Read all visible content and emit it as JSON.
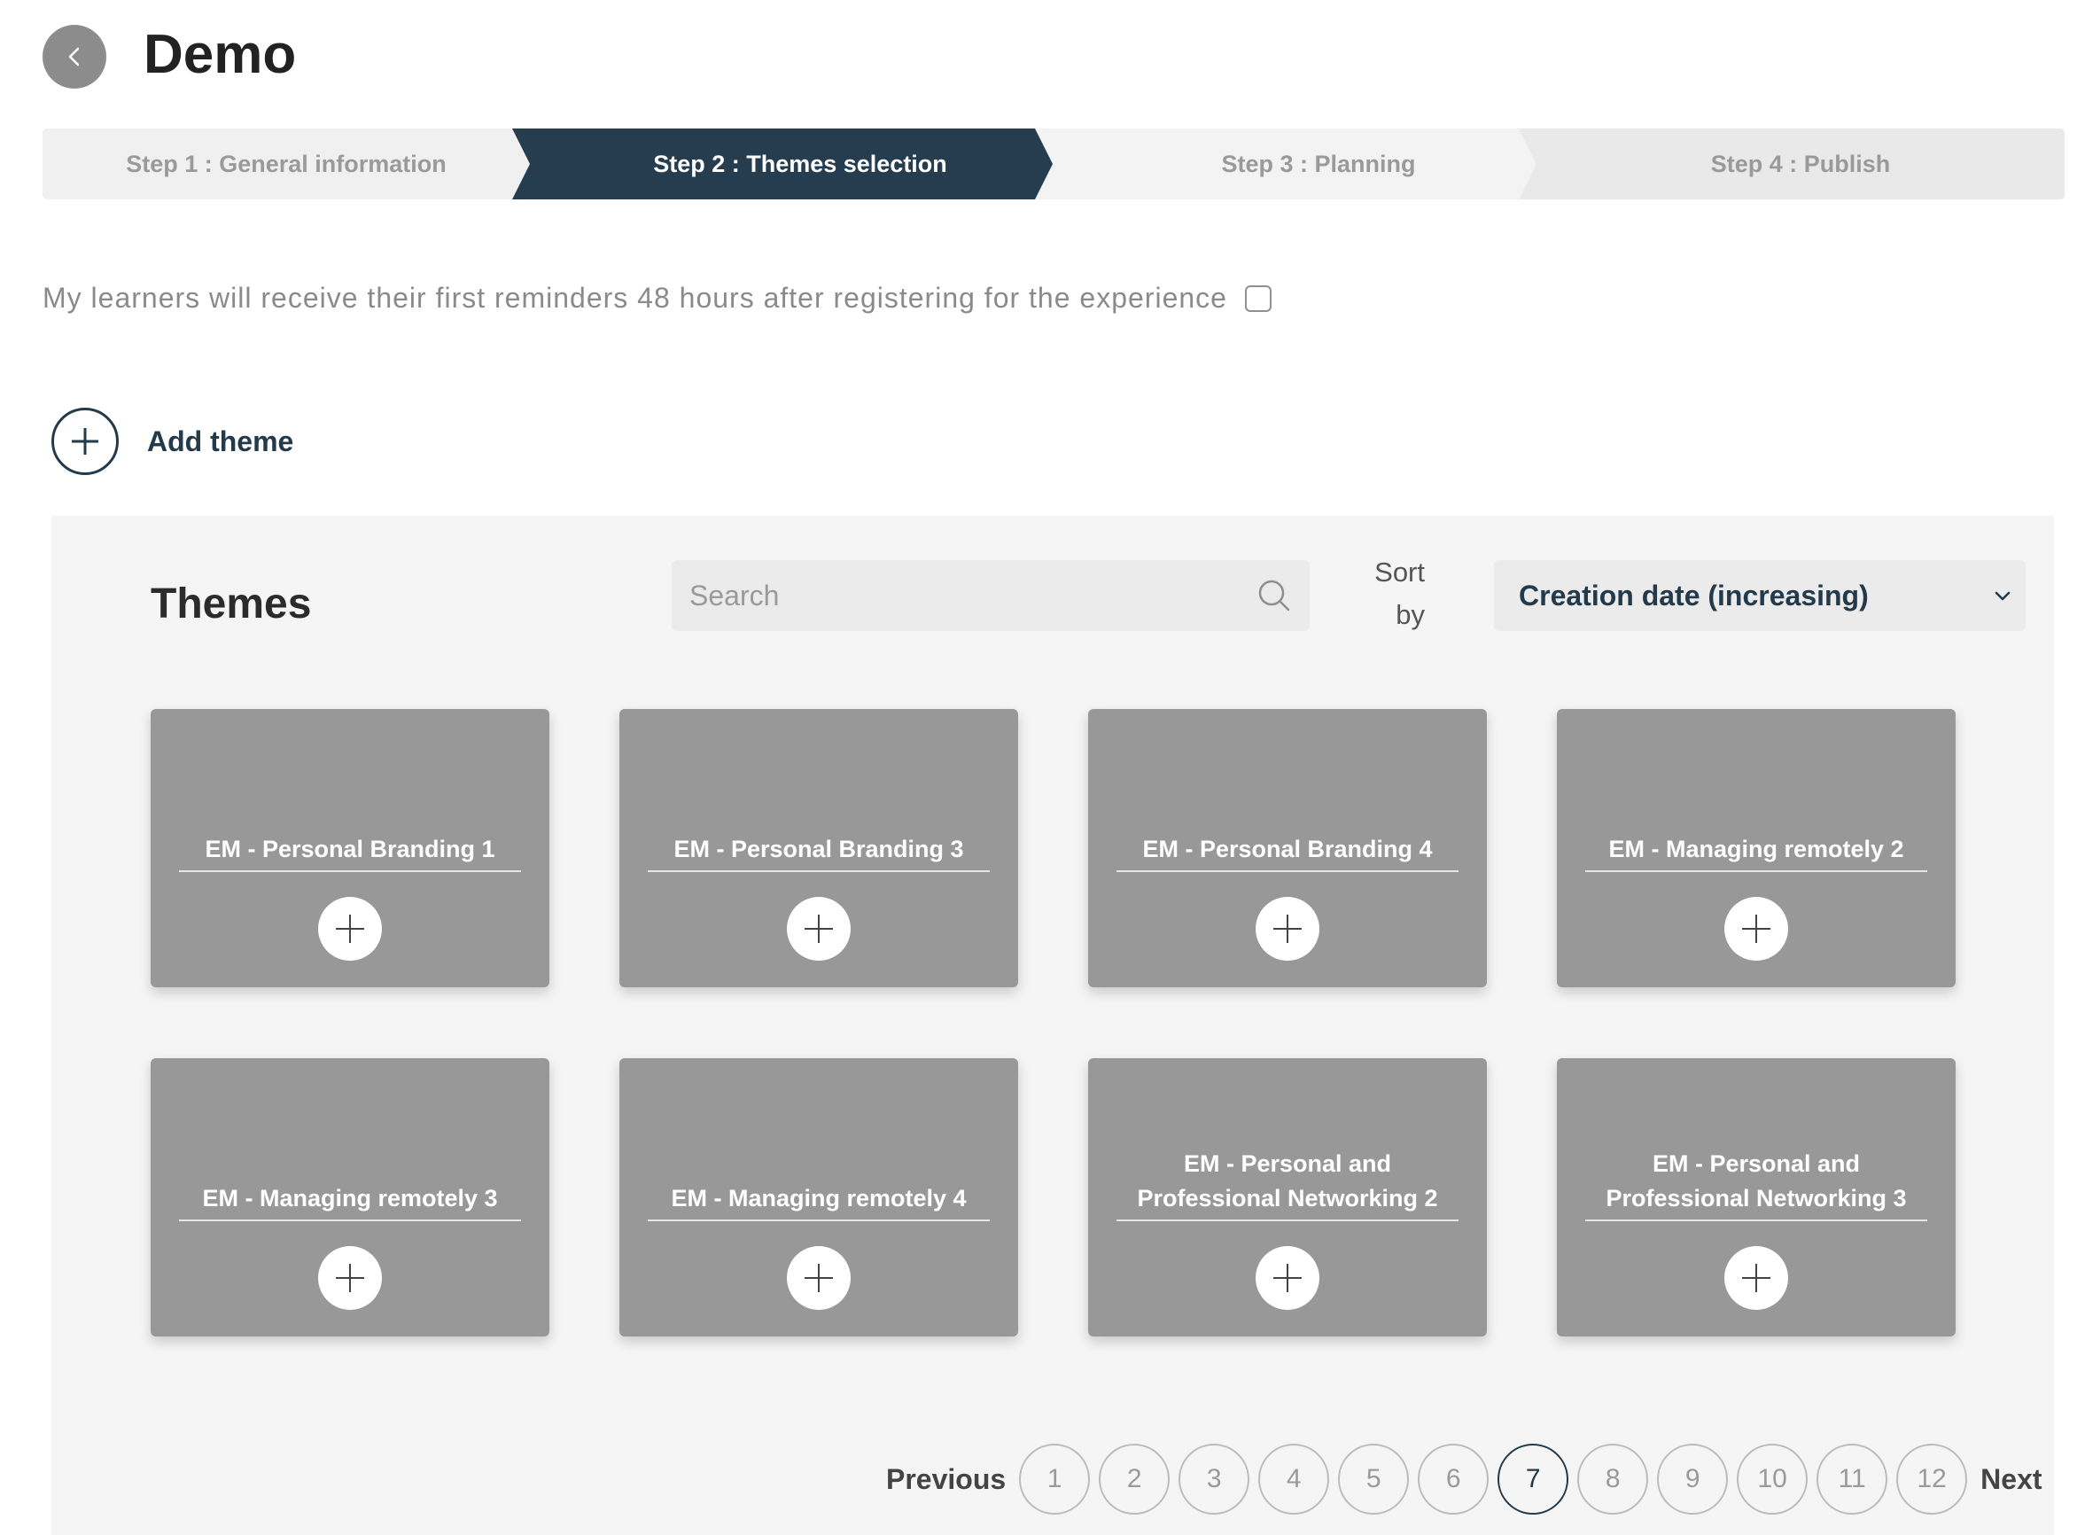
{
  "header": {
    "title": "Demo"
  },
  "steps": [
    {
      "label": "Step 1 : General information",
      "state": "done"
    },
    {
      "label": "Step 2 : Themes selection",
      "state": "active"
    },
    {
      "label": "Step 3 : Planning",
      "state": "upcoming"
    },
    {
      "label": "Step 4 : Publish",
      "state": "upcoming"
    }
  ],
  "reminder": {
    "label": "My learners will receive their first reminders 48 hours after registering for the experience",
    "checked": false
  },
  "add_theme": {
    "label": "Add theme"
  },
  "themes_panel": {
    "title": "Themes",
    "search_placeholder": "Search",
    "sort_label_line1": "Sort",
    "sort_label_line2": "by",
    "sort_value": "Creation date (increasing)"
  },
  "cards": [
    {
      "title": "EM - Personal Branding 1"
    },
    {
      "title": "EM - Personal Branding 3"
    },
    {
      "title": "EM - Personal Branding 4"
    },
    {
      "title": "EM - Managing remotely 2"
    },
    {
      "title": "EM - Managing remotely 3"
    },
    {
      "title": "EM - Managing remotely 4"
    },
    {
      "title": "EM - Personal and Professional Networking 2"
    },
    {
      "title": "EM - Personal and Professional Networking 3"
    }
  ],
  "pagination": {
    "previous": "Previous",
    "next": "Next",
    "pages": [
      "1",
      "2",
      "3",
      "4",
      "5",
      "6",
      "7",
      "8",
      "9",
      "10",
      "11",
      "12"
    ],
    "current": "7"
  },
  "colors": {
    "accent": "#233a4b",
    "card": "#989898",
    "panel": "#f5f5f5",
    "step_done": "#f0f0f0",
    "step_upcoming": "#e8e8e8"
  },
  "icons": {
    "back": "chevron-left-icon",
    "add": "plus-icon",
    "search": "search-icon",
    "sort": "chevron-down-icon"
  }
}
